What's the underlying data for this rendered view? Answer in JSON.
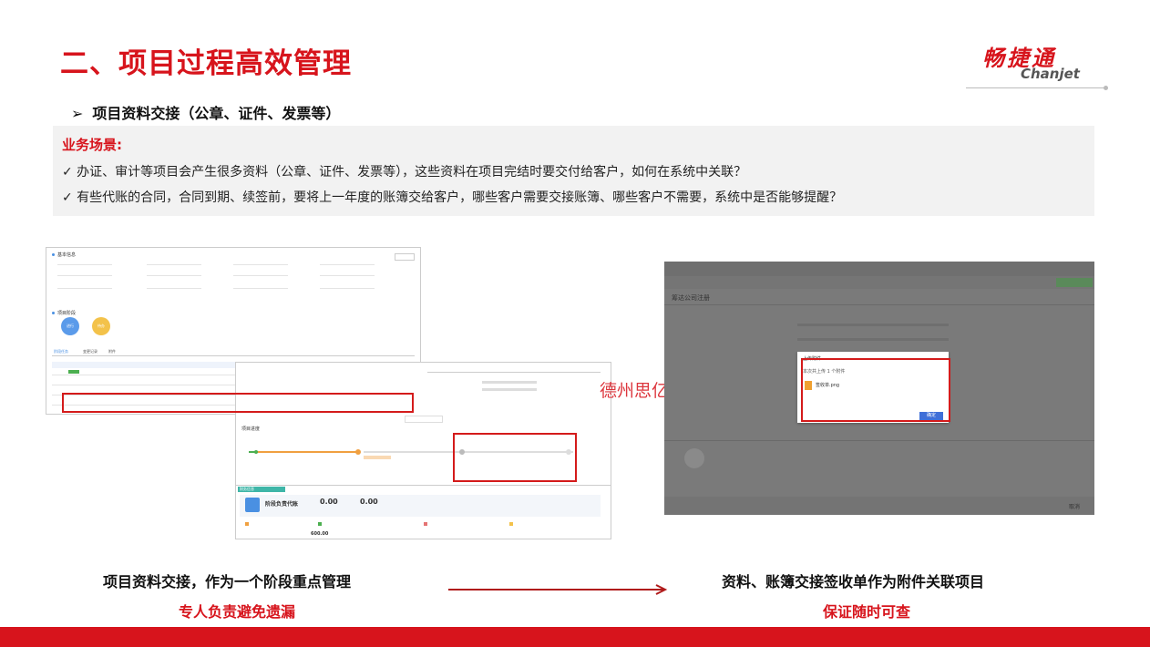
{
  "header": {
    "title": "二、项目过程高效管理",
    "logo_cn": "畅捷通",
    "logo_en": "Chanjet"
  },
  "section": {
    "subtitle_arrow": "➢",
    "subtitle": "项目资料交接（公章、证件、发票等）"
  },
  "scenario": {
    "label": "业务场景:",
    "lines": [
      "✓ 办证、审计等项目会产生很多资料（公章、证件、发票等），这些资料在项目完结时要交付给客户，如何在系统中关联？",
      "✓ 有些代账的合同，合同到期、续签前，要将上一年度的账簿交给客户，哪些客户需要交接账簿、哪些客户不需要，系统中是否能够提醒？"
    ]
  },
  "left_screens": {
    "screen1": {
      "section_basic": "基本信息",
      "section_stage": "项目阶段",
      "tabs": [
        "阶段任务",
        "变更记录",
        "附件"
      ],
      "stage_badges": [
        "进行",
        "待办"
      ]
    },
    "screen2": {
      "progress_label": "项目进度",
      "finance_tag": "财务信息",
      "finance_title": "阶段负责代账",
      "amount1": "0.00",
      "amount2": "0.00",
      "amount3": "600.00"
    }
  },
  "right_screen": {
    "page_title": "筹达公司注册",
    "dialog_title": "上传附件",
    "dialog_message": "本次共上传 1 个附件",
    "file_name": "签收单.png",
    "confirm_button": "确定",
    "cancel_button": "取消"
  },
  "watermark": "德州思亿能程",
  "captions": {
    "left_main": "项目资料交接，作为一个阶段重点管理",
    "left_sub": "专人负责避免遗漏",
    "right_main": "资料、账簿交接签收单作为附件关联项目",
    "right_sub": "保证随时可查"
  },
  "colors": {
    "brand_red": "#d7141c",
    "highlight_red": "#d41b1b",
    "accent_blue": "#4a90e2",
    "scene_bg": "#f2f2f2"
  }
}
